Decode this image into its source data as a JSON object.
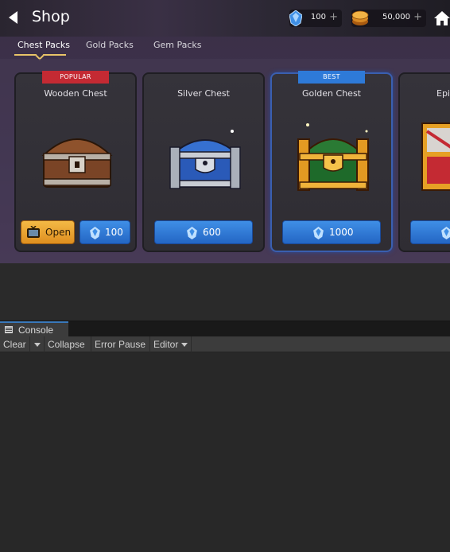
{
  "game": {
    "header": {
      "title": "Shop",
      "back_icon": "back-arrow-icon",
      "home_icon": "home-icon"
    },
    "resources": {
      "gems": {
        "value": "100",
        "plus": "+",
        "icon": "gem-icon"
      },
      "gold": {
        "value": "50,000",
        "plus": "+",
        "icon": "gold-coin-icon"
      }
    },
    "tabs": [
      {
        "label": "Chest Packs",
        "active": true
      },
      {
        "label": "Gold Packs",
        "active": false
      },
      {
        "label": "Gem Packs",
        "active": false
      }
    ],
    "cards": [
      {
        "name": "Wooden Chest",
        "badge": "POPULAR",
        "open_label": "Open",
        "price": "100"
      },
      {
        "name": "Silver Chest",
        "badge": "",
        "price": "600"
      },
      {
        "name": "Golden Chest",
        "badge": "BEST",
        "price": "1000"
      },
      {
        "name": "Epi",
        "badge": "",
        "price": ""
      }
    ],
    "colors": {
      "accent_gold": "#e8c468",
      "button_blue": "#2e7ad8",
      "badge_red": "#c42a33",
      "badge_blue": "#2e7ad8"
    }
  },
  "console": {
    "tab_label": "Console",
    "toolbar": {
      "clear": "Clear",
      "collapse": "Collapse",
      "error_pause": "Error Pause",
      "editor": "Editor"
    }
  }
}
